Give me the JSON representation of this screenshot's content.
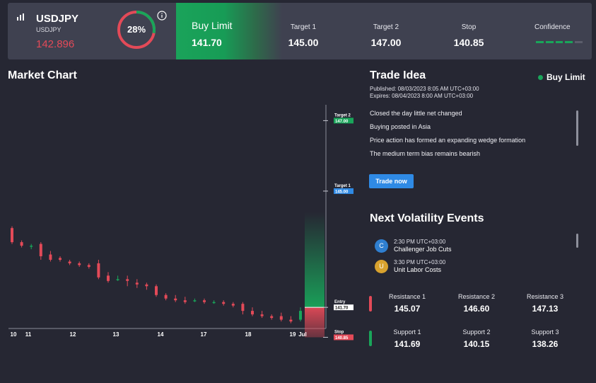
{
  "header": {
    "symbol": "USDJPY",
    "symbol_sub": "USDJPY",
    "price": "142.896",
    "gauge_pct": 28,
    "gauge_label": "28%",
    "signal_label": "Buy Limit",
    "signal_value": "141.70",
    "stats": [
      {
        "label": "Target 1",
        "value": "145.00"
      },
      {
        "label": "Target 2",
        "value": "147.00"
      },
      {
        "label": "Stop",
        "value": "140.85"
      }
    ],
    "confidence_label": "Confidence",
    "confidence_level": 4,
    "confidence_max": 5
  },
  "market_chart": {
    "title": "Market Chart"
  },
  "chart_data": {
    "type": "candlestick",
    "x_tick_labels": [
      "10",
      "11",
      "12",
      "13",
      "14",
      "17",
      "18",
      "19",
      "Jul"
    ],
    "candles": [
      {
        "o": 143.95,
        "h": 144.0,
        "c": 143.55,
        "l": 143.5
      },
      {
        "o": 143.55,
        "h": 143.6,
        "c": 143.45,
        "l": 143.4
      },
      {
        "o": 143.45,
        "h": 143.5,
        "c": 143.45,
        "l": 143.35
      },
      {
        "o": 143.5,
        "h": 143.55,
        "c": 143.15,
        "l": 143.05
      },
      {
        "o": 143.2,
        "h": 143.3,
        "c": 143.05,
        "l": 143.0
      },
      {
        "o": 143.1,
        "h": 143.15,
        "c": 143.05,
        "l": 143.0
      },
      {
        "o": 143.0,
        "h": 143.05,
        "c": 142.95,
        "l": 142.9
      },
      {
        "o": 142.95,
        "h": 143.0,
        "c": 142.9,
        "l": 142.85
      },
      {
        "o": 142.9,
        "h": 142.95,
        "c": 142.85,
        "l": 142.8
      },
      {
        "o": 142.95,
        "h": 143.05,
        "c": 142.55,
        "l": 142.5
      },
      {
        "o": 142.6,
        "h": 142.7,
        "c": 142.45,
        "l": 142.4
      },
      {
        "o": 142.5,
        "h": 142.6,
        "c": 142.5,
        "l": 142.45
      },
      {
        "o": 142.5,
        "h": 142.6,
        "c": 142.45,
        "l": 142.3
      },
      {
        "o": 142.4,
        "h": 142.5,
        "c": 142.35,
        "l": 142.25
      },
      {
        "o": 142.35,
        "h": 142.4,
        "c": 142.3,
        "l": 142.2
      },
      {
        "o": 142.3,
        "h": 142.35,
        "c": 142.05,
        "l": 142.0
      },
      {
        "o": 142.05,
        "h": 142.1,
        "c": 141.95,
        "l": 141.9
      },
      {
        "o": 141.95,
        "h": 142.05,
        "c": 141.9,
        "l": 141.85
      },
      {
        "o": 141.9,
        "h": 142.0,
        "c": 141.85,
        "l": 141.8
      },
      {
        "o": 141.9,
        "h": 141.95,
        "c": 141.9,
        "l": 141.85
      },
      {
        "o": 141.9,
        "h": 141.95,
        "c": 141.85,
        "l": 141.8
      },
      {
        "o": 141.85,
        "h": 141.9,
        "c": 141.85,
        "l": 141.8
      },
      {
        "o": 141.85,
        "h": 141.9,
        "c": 141.8,
        "l": 141.75
      },
      {
        "o": 141.8,
        "h": 141.85,
        "c": 141.75,
        "l": 141.7
      },
      {
        "o": 141.8,
        "h": 141.85,
        "c": 141.6,
        "l": 141.5
      },
      {
        "o": 141.6,
        "h": 141.7,
        "c": 141.5,
        "l": 141.45
      },
      {
        "o": 141.5,
        "h": 141.6,
        "c": 141.45,
        "l": 141.4
      },
      {
        "o": 141.45,
        "h": 141.5,
        "c": 141.4,
        "l": 141.35
      },
      {
        "o": 141.45,
        "h": 141.55,
        "c": 141.35,
        "l": 141.3
      },
      {
        "o": 141.35,
        "h": 141.45,
        "c": 141.3,
        "l": 141.25
      },
      {
        "o": 141.35,
        "h": 141.7,
        "c": 141.6,
        "l": 141.3
      }
    ],
    "price_range": [
      141.1,
      147.45
    ],
    "annotations": [
      {
        "label": "Target 2",
        "value": "147.00"
      },
      {
        "label": "Target 1",
        "value": "145.00"
      },
      {
        "label": "Entry",
        "value": "141.70"
      },
      {
        "label": "Stop",
        "value": "140.85"
      }
    ],
    "colors": {
      "up": "#19a55a",
      "down": "#e34a58",
      "target": "#19a55a",
      "target1": "#2f8ae5",
      "entry": "#ffffff",
      "stop": "#e34a58"
    }
  },
  "trade_idea": {
    "title": "Trade Idea",
    "badge": "Buy Limit",
    "published": "Published: 08/03/2023 8:05 AM UTC+03:00",
    "expires": "Expires: 08/04/2023 8:00 AM UTC+03:00",
    "points": [
      "Closed the day little net changed",
      "Buying posted in Asia",
      "Price action has formed an expanding wedge formation",
      "The medium term bias remains bearish"
    ],
    "button": "Trade now"
  },
  "volatility": {
    "title": "Next Volatility Events",
    "events": [
      {
        "badge": "C",
        "time": "2:30 PM UTC+03:00",
        "name": "Challenger Job Cuts",
        "color": "#2f7fd0"
      },
      {
        "badge": "U",
        "time": "3:30 PM UTC+03:00",
        "name": "Unit Labor Costs",
        "color": "#d8a22e"
      }
    ]
  },
  "levels": {
    "resistance": [
      {
        "label": "Resistance 1",
        "value": "145.07"
      },
      {
        "label": "Resistance 2",
        "value": "146.60"
      },
      {
        "label": "Resistance 3",
        "value": "147.13"
      }
    ],
    "support": [
      {
        "label": "Support 1",
        "value": "141.69"
      },
      {
        "label": "Support 2",
        "value": "140.15"
      },
      {
        "label": "Support 3",
        "value": "138.26"
      }
    ]
  }
}
